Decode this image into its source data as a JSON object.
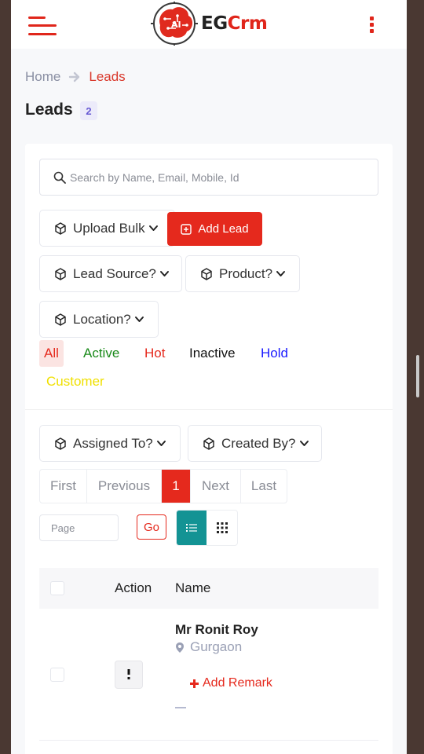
{
  "header": {
    "logo_text_dark": "EG",
    "logo_text_accent": "Crm",
    "logo_mark_text": "AI",
    "accent_color": "#e5291d"
  },
  "breadcrumb": {
    "home": "Home",
    "current": "Leads"
  },
  "page": {
    "title": "Leads",
    "count": "2"
  },
  "search": {
    "placeholder": "Search by Name, Email, Mobile, Id",
    "value": ""
  },
  "toolbar": {
    "upload_bulk": "Upload Bulk",
    "add_lead": "Add Lead",
    "lead_source": "Lead Source?",
    "product": "Product?",
    "location": "Location?",
    "assigned_to": "Assigned To?",
    "created_by": "Created By?"
  },
  "status_filters": [
    {
      "label": "All",
      "color": "#e5291d",
      "selected": true
    },
    {
      "label": "Active",
      "color": "#1a8a1a"
    },
    {
      "label": "Hot",
      "color": "#e5291d"
    },
    {
      "label": "Inactive",
      "color": "#111111"
    },
    {
      "label": "Hold",
      "color": "#1a1aff"
    },
    {
      "label": "Customer",
      "color": "#f0e000"
    }
  ],
  "pagination": {
    "first": "First",
    "previous": "Previous",
    "current": "1",
    "next": "Next",
    "last": "Last",
    "page_placeholder": "Page",
    "go": "Go"
  },
  "table": {
    "columns": [
      "Action",
      "Name"
    ],
    "rows": [
      {
        "name": "Mr Ronit Roy",
        "location": "Gurgaon",
        "remark_link": "Add Remark",
        "extra": "—"
      }
    ]
  }
}
